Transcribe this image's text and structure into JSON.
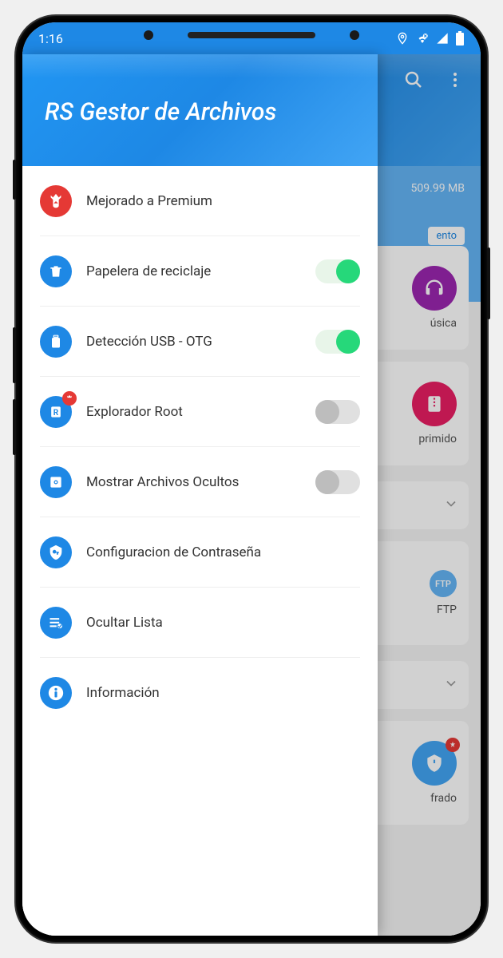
{
  "status": {
    "time": "1:16"
  },
  "header": {
    "title": "RS Gestor de Archivos"
  },
  "drawer": {
    "title": "RS Gestor de Archivos",
    "items": [
      {
        "label": "Mejorado a Premium",
        "icon": "premium",
        "toggle": null,
        "badge": false
      },
      {
        "label": "Papelera de reciclaje",
        "icon": "trash",
        "toggle": true,
        "badge": false
      },
      {
        "label": "Detección USB - OTG",
        "icon": "usb",
        "toggle": true,
        "badge": false
      },
      {
        "label": "Explorador Root",
        "icon": "root",
        "toggle": false,
        "badge": true
      },
      {
        "label": "Mostrar Archivos Ocultos",
        "icon": "hidden",
        "toggle": false,
        "badge": false
      },
      {
        "label": "Configuracion de Contraseña",
        "icon": "password",
        "toggle": null,
        "badge": false
      },
      {
        "label": "Ocultar Lista",
        "icon": "list",
        "toggle": null,
        "badge": false
      },
      {
        "label": "Información",
        "icon": "info",
        "toggle": null,
        "badge": false
      }
    ]
  },
  "background": {
    "storage_info": "509.99 MB",
    "storage_action": "ento",
    "tiles": [
      {
        "label": "úsica",
        "color": "#9c27b0"
      },
      {
        "label": "primido",
        "color": "#e91e63"
      },
      {
        "label": "FTP",
        "color": "#64b5f6",
        "ftp": "FTP"
      },
      {
        "label": "frado",
        "color": "#42a5f5"
      }
    ]
  }
}
